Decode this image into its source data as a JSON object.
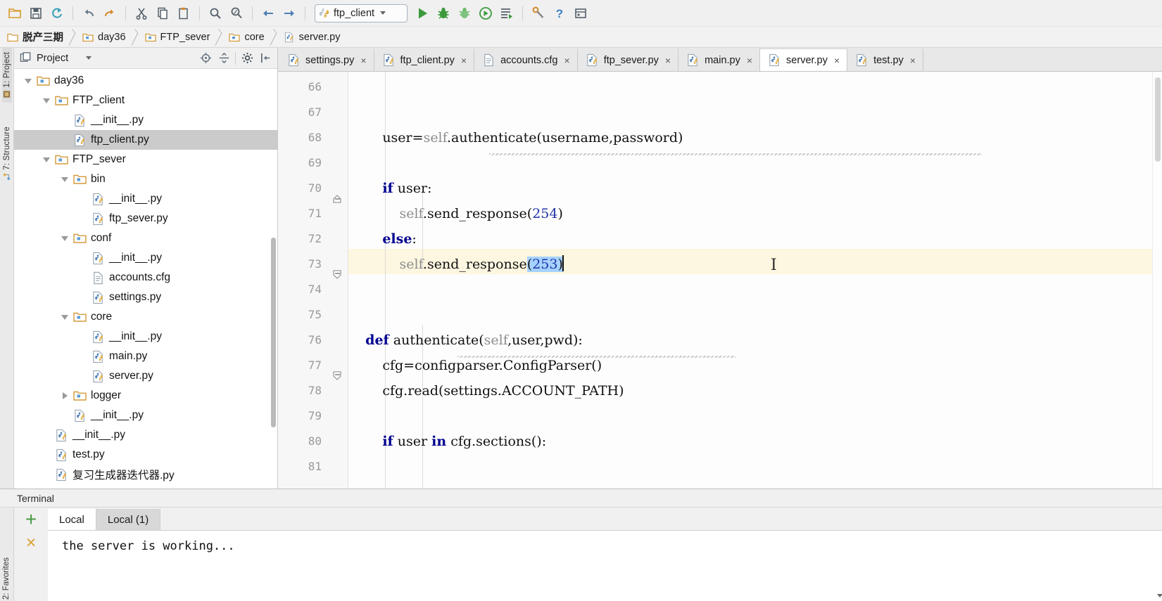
{
  "toolbar": {
    "buttons": [
      {
        "name": "open-folder-icon",
        "title": "Open"
      },
      {
        "name": "save-all-icon",
        "title": "Save All"
      },
      {
        "name": "sync-refresh-icon",
        "title": "Synchronize"
      },
      {
        "name": "undo-icon",
        "title": "Undo"
      },
      {
        "name": "redo-icon",
        "title": "Redo"
      },
      {
        "name": "cut-icon",
        "title": "Cut"
      },
      {
        "name": "copy-icon",
        "title": "Copy"
      },
      {
        "name": "paste-icon",
        "title": "Paste"
      },
      {
        "name": "find-icon",
        "title": "Find"
      },
      {
        "name": "replace-icon",
        "title": "Replace"
      },
      {
        "name": "back-icon",
        "title": "Back"
      },
      {
        "name": "forward-icon",
        "title": "Forward"
      }
    ],
    "run_config": {
      "label": "ftp_client",
      "icon": "python-run-config-icon"
    },
    "run_buttons": [
      {
        "name": "run-icon",
        "title": "Run"
      },
      {
        "name": "debug-icon",
        "title": "Debug"
      },
      {
        "name": "coverage-icon",
        "title": "Run with Coverage"
      },
      {
        "name": "profile-icon",
        "title": "Profile"
      },
      {
        "name": "run-with-console-icon",
        "title": "Run with Console"
      },
      {
        "name": "settings-wrench-icon",
        "title": "Settings"
      },
      {
        "name": "help-icon",
        "title": "Help"
      },
      {
        "name": "vcs-update-icon",
        "title": "Update Project"
      }
    ]
  },
  "breadcrumb": [
    {
      "label": "脱产三期",
      "icon": "folder-icon"
    },
    {
      "label": "day36",
      "icon": "module-folder-icon"
    },
    {
      "label": "FTP_sever",
      "icon": "module-folder-icon"
    },
    {
      "label": "core",
      "icon": "module-folder-icon"
    },
    {
      "label": "server.py",
      "icon": "python-file-icon"
    }
  ],
  "left_strip": [
    {
      "label": "1: Project",
      "icon": "project-icon",
      "selected": true
    },
    {
      "label": "7: Structure",
      "icon": "structure-icon",
      "selected": false
    }
  ],
  "bottom_strip": [
    {
      "label": "2: Favorites",
      "icon": "favorites-icon"
    }
  ],
  "project_panel": {
    "title": "Project",
    "header_icons": [
      {
        "name": "target-locate-icon"
      },
      {
        "name": "collapse-all-icon"
      },
      {
        "name": "gear-settings-icon"
      },
      {
        "name": "hide-panel-icon"
      }
    ],
    "tree": [
      {
        "label": "day36",
        "icon": "module-folder-icon",
        "depth": 1,
        "twist": "down",
        "selected": false
      },
      {
        "label": "FTP_client",
        "icon": "module-folder-icon",
        "depth": 2,
        "twist": "down",
        "selected": false
      },
      {
        "label": "__init__.py",
        "icon": "python-file-icon",
        "depth": 3,
        "twist": "none",
        "selected": false
      },
      {
        "label": "ftp_client.py",
        "icon": "python-file-icon",
        "depth": 3,
        "twist": "none",
        "selected": true
      },
      {
        "label": "FTP_sever",
        "icon": "module-folder-icon",
        "depth": 2,
        "twist": "down",
        "selected": false
      },
      {
        "label": "bin",
        "icon": "module-folder-icon",
        "depth": 3,
        "twist": "down",
        "selected": false
      },
      {
        "label": "__init__.py",
        "icon": "python-file-icon",
        "depth": 4,
        "twist": "none",
        "selected": false
      },
      {
        "label": "ftp_sever.py",
        "icon": "python-file-icon",
        "depth": 4,
        "twist": "none",
        "selected": false
      },
      {
        "label": "conf",
        "icon": "module-folder-icon",
        "depth": 3,
        "twist": "down",
        "selected": false
      },
      {
        "label": "__init__.py",
        "icon": "python-file-icon",
        "depth": 4,
        "twist": "none",
        "selected": false
      },
      {
        "label": "accounts.cfg",
        "icon": "text-file-icon",
        "depth": 4,
        "twist": "none",
        "selected": false
      },
      {
        "label": "settings.py",
        "icon": "python-file-icon",
        "depth": 4,
        "twist": "none",
        "selected": false
      },
      {
        "label": "core",
        "icon": "module-folder-icon",
        "depth": 3,
        "twist": "down",
        "selected": false
      },
      {
        "label": "__init__.py",
        "icon": "python-file-icon",
        "depth": 4,
        "twist": "none",
        "selected": false
      },
      {
        "label": "main.py",
        "icon": "python-file-icon",
        "depth": 4,
        "twist": "none",
        "selected": false
      },
      {
        "label": "server.py",
        "icon": "python-file-icon",
        "depth": 4,
        "twist": "none",
        "selected": false
      },
      {
        "label": "logger",
        "icon": "module-folder-icon",
        "depth": 3,
        "twist": "right",
        "selected": false
      },
      {
        "label": "__init__.py",
        "icon": "python-file-icon",
        "depth": 3,
        "twist": "none",
        "selected": false
      },
      {
        "label": "__init__.py",
        "icon": "python-file-icon",
        "depth": 2,
        "twist": "none",
        "selected": false
      },
      {
        "label": "test.py",
        "icon": "python-file-icon",
        "depth": 2,
        "twist": "none",
        "selected": false
      },
      {
        "label": "复习生成器迭代器.py",
        "icon": "python-file-icon",
        "depth": 2,
        "twist": "none",
        "selected": false
      }
    ]
  },
  "editor_tabs": [
    {
      "label": "settings.py",
      "icon": "python-file-icon",
      "active": false,
      "close": "×"
    },
    {
      "label": "ftp_client.py",
      "icon": "python-file-icon",
      "active": false,
      "close": "×"
    },
    {
      "label": "accounts.cfg",
      "icon": "text-file-icon",
      "active": false,
      "close": "×"
    },
    {
      "label": "ftp_sever.py",
      "icon": "python-file-icon",
      "active": false,
      "close": "×"
    },
    {
      "label": "main.py",
      "icon": "python-file-icon",
      "active": false,
      "close": "×"
    },
    {
      "label": "server.py",
      "icon": "python-file-icon",
      "active": true,
      "close": "×"
    },
    {
      "label": "test.py",
      "icon": "python-file-icon",
      "active": false,
      "close": "×"
    }
  ],
  "editor": {
    "file": "server.py",
    "caret_line": 73,
    "selection": "(253)",
    "line_numbers": [
      66,
      67,
      68,
      69,
      70,
      71,
      72,
      73,
      74,
      75,
      76,
      77,
      78,
      79,
      80,
      81
    ],
    "lines": [
      {
        "n": 66,
        "text": ""
      },
      {
        "n": 67,
        "text": ""
      },
      {
        "n": 68,
        "text": "        user=self.authenticate(username,password)"
      },
      {
        "n": 69,
        "text": ""
      },
      {
        "n": 70,
        "text": "        if user:"
      },
      {
        "n": 71,
        "text": "            self.send_response(254)"
      },
      {
        "n": 72,
        "text": "        else:"
      },
      {
        "n": 73,
        "text": "            self.send_response(253)"
      },
      {
        "n": 74,
        "text": ""
      },
      {
        "n": 75,
        "text": ""
      },
      {
        "n": 76,
        "text": "    def authenticate(self,user,pwd):"
      },
      {
        "n": 77,
        "text": "        cfg=configparser.ConfigParser()"
      },
      {
        "n": 78,
        "text": "        cfg.read(settings.ACCOUNT_PATH)"
      },
      {
        "n": 79,
        "text": ""
      },
      {
        "n": 80,
        "text": "        if user in cfg.sections():"
      },
      {
        "n": 81,
        "text": ""
      }
    ]
  },
  "terminal": {
    "title": "Terminal",
    "add_button": "+",
    "close_button": "×",
    "tabs": [
      {
        "label": "Local",
        "active": true
      },
      {
        "label": "Local (1)",
        "active": false
      }
    ],
    "output": "the server is working..."
  },
  "colors": {
    "keyword": "#00008f",
    "number": "#2233aa",
    "selection": "#a6d2ff",
    "caret_line": "#fdf6e0",
    "selected_tree_row": "#cbcbcb",
    "run_green": "#3c9a3c",
    "accent_orange": "#d9a22e"
  }
}
